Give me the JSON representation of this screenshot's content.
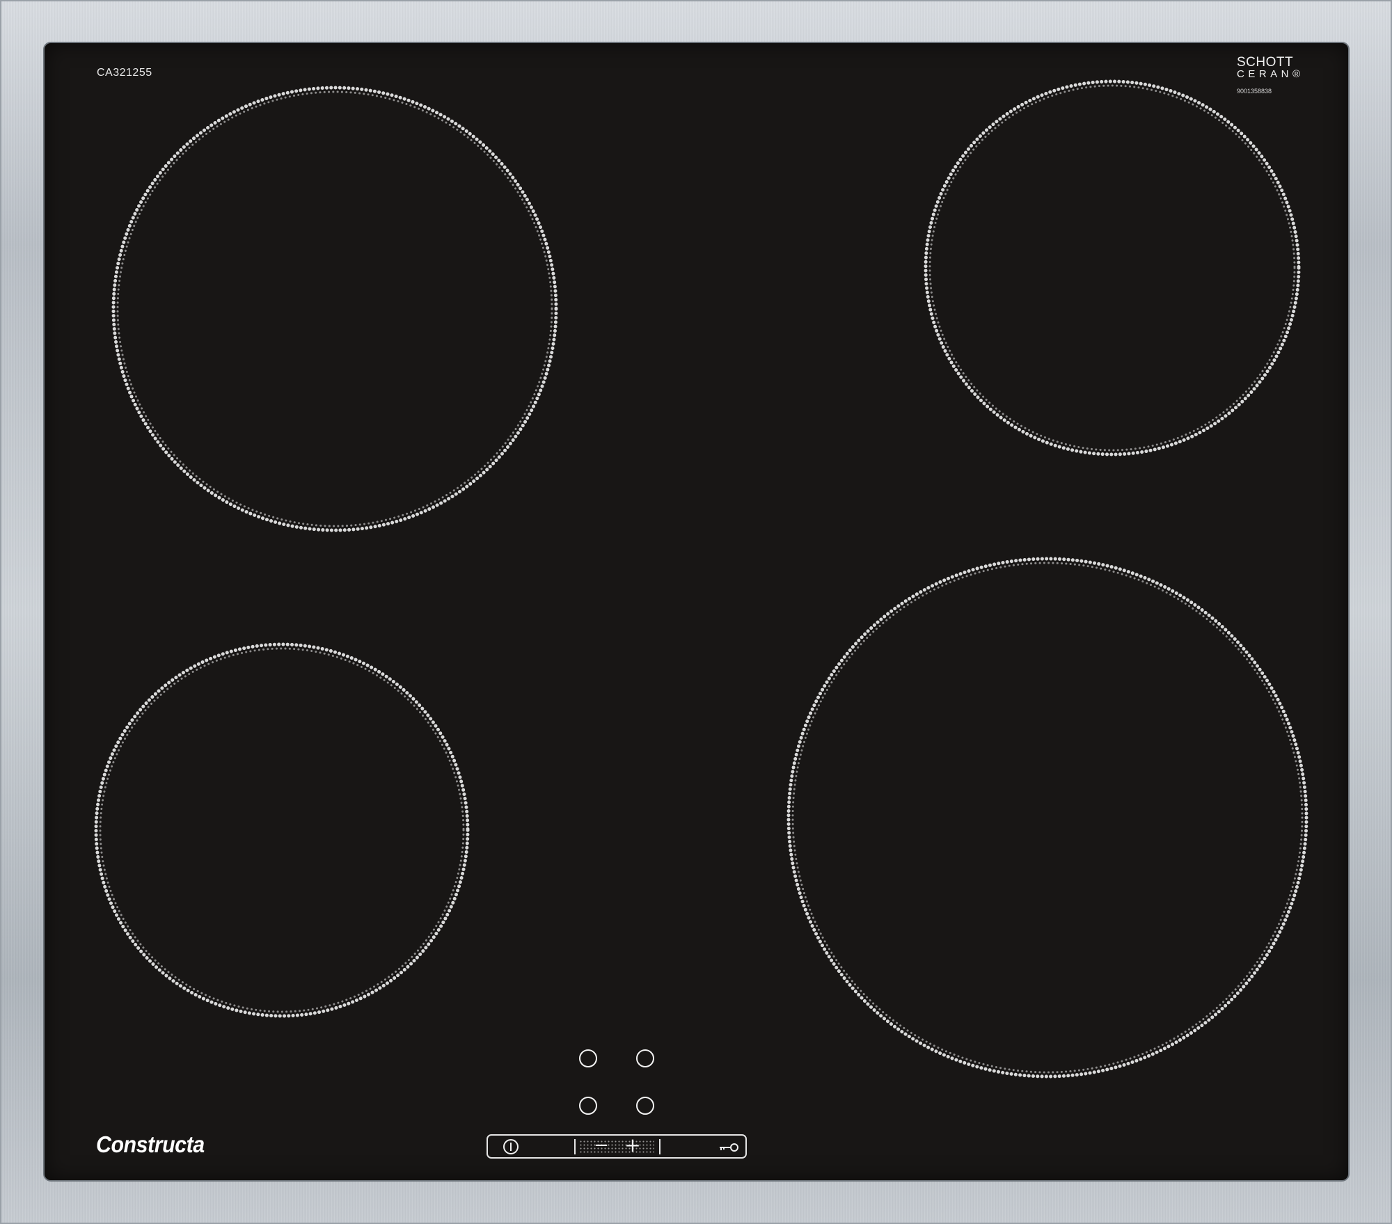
{
  "hob": {
    "model_number": "CA321255",
    "brand": "Constructa",
    "glass_brand": {
      "line1": "SCHOTT",
      "line2": "CERAN®"
    },
    "part_number": "9001358838"
  },
  "controls": {
    "cooking_zone_indicators": 4,
    "buttons": [
      "power-icon",
      "minus-icon",
      "plus-icon",
      "key-lock-icon"
    ]
  },
  "colors": {
    "glass": "#181615",
    "frame": "#c3c8ce",
    "marking": "#f2f2f2"
  }
}
